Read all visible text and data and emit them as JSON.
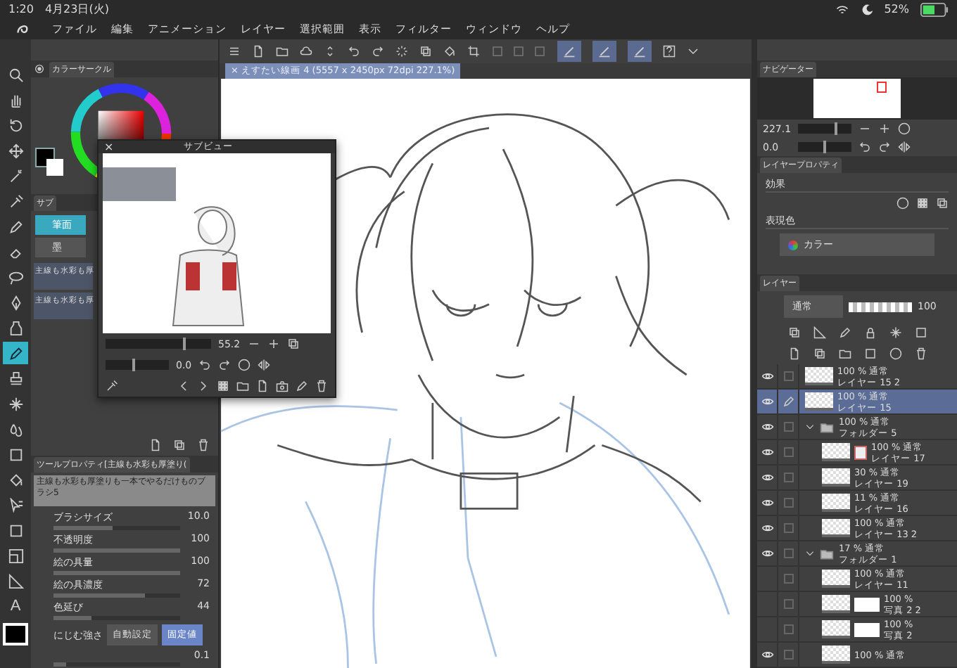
{
  "status_bar": {
    "time": "1:20",
    "date": "4月23日(火)",
    "battery": "52%"
  },
  "menu": [
    "ファイル",
    "編集",
    "アニメーション",
    "レイヤー",
    "選択範囲",
    "表示",
    "フィルター",
    "ウィンドウ",
    "ヘルプ"
  ],
  "toolbar": {
    "pen_buttons": [
      {
        "selected": true
      },
      {
        "selected": true
      },
      {
        "selected": true
      }
    ]
  },
  "canvas_tab": {
    "close": "×",
    "title": "えすたい線画 4 (5557 x 2450px 72dpi 227.1%)"
  },
  "tools": [
    {
      "selected": false
    },
    {
      "selected": false
    },
    {
      "selected": false
    },
    {
      "selected": false
    },
    {
      "selected": false
    },
    {
      "selected": false
    },
    {
      "selected": false
    },
    {
      "selected": false
    },
    {
      "selected": false
    },
    {
      "selected": false
    },
    {
      "selected": false
    },
    {
      "selected": true
    },
    {
      "selected": false
    },
    {
      "selected": false
    },
    {
      "selected": false
    },
    {
      "selected": false
    },
    {
      "selected": false
    },
    {
      "selected": false
    },
    {
      "selected": false
    },
    {
      "selected": false
    },
    {
      "selected": false
    },
    {
      "selected": false,
      "glyph": "A"
    }
  ],
  "color_panel": {
    "tab": "カラーサークル"
  },
  "sub_tool_panel": {
    "tab": "サブ",
    "brushes": [
      {
        "label": "筆面",
        "selected": true
      },
      {
        "label": "墨",
        "selected": false
      }
    ],
    "presets": [
      "主線も水彩も厚",
      "主線も水彩も厚"
    ]
  },
  "subview": {
    "close": "×",
    "title": "サブビュー",
    "zoom": "55.2",
    "zoom_slider": {
      "level": 0.75
    },
    "angle": "0.0",
    "angle_slider": {
      "level": 0.45
    }
  },
  "tool_property": {
    "title": "ツールプロパティ[主線も水彩も厚塗り(",
    "brush_name": "主線も水彩も厚塗りも一本でやるだけものブラシ5",
    "rows": [
      {
        "label": "ブラシサイズ",
        "value": "10.0",
        "level": 0.47
      },
      {
        "label": "不透明度",
        "value": "100",
        "level": 1
      },
      {
        "label": "絵の具量",
        "value": "100",
        "level": 1
      },
      {
        "label": "絵の具濃度",
        "value": "72",
        "level": 0.72
      },
      {
        "label": "色延び",
        "value": "44",
        "level": 0.3
      }
    ],
    "bleed_label": "にじむ強さ",
    "bleed_options": [
      {
        "label": "自動設定",
        "selected": false
      },
      {
        "label": "固定値",
        "selected": true
      }
    ],
    "bleed_value": "0.1",
    "bleed_slider": {
      "level": 0.1
    }
  },
  "navigator": {
    "tab": "ナビゲーター",
    "zoom": "227.1",
    "zoom_slider": {
      "level": 0.7
    },
    "angle": "0.0",
    "angle_slider": {
      "level": 0.5
    }
  },
  "layer_property": {
    "tab": "レイヤープロパティ",
    "effect_label": "効果",
    "color_label": "表現色",
    "color_mode": "カラー"
  },
  "layers": {
    "tab": "レイヤー",
    "blend_mode": "通常",
    "opacity": "100",
    "opacity_slider": {
      "level": 1
    },
    "items": [
      {
        "kind": "layer",
        "opacity": "100 %",
        "mode": "通常",
        "name": "レイヤー 15 2",
        "visible": true,
        "selected": false
      },
      {
        "kind": "layer",
        "opacity": "100 %",
        "mode": "通常",
        "name": "レイヤー 15",
        "visible": true,
        "selected": true
      },
      {
        "kind": "folder",
        "opacity": "100 %",
        "mode": "通常",
        "name": "フォルダー 5",
        "visible": true,
        "selected": false,
        "expanded": true,
        "children": [
          {
            "kind": "layer",
            "opacity": "100 %",
            "mode": "通常",
            "name": "レイヤー 17",
            "visible": true,
            "selected": false,
            "masked": true
          },
          {
            "kind": "layer",
            "opacity": "30 %",
            "mode": "通常",
            "name": "レイヤー 19",
            "visible": true,
            "selected": false
          },
          {
            "kind": "layer",
            "opacity": "11 %",
            "mode": "通常",
            "name": "レイヤー 16",
            "visible": true,
            "selected": false
          },
          {
            "kind": "layer",
            "opacity": "100 %",
            "mode": "通常",
            "name": "レイヤー 13 2",
            "visible": true,
            "selected": false
          }
        ]
      },
      {
        "kind": "folder",
        "opacity": "17 %",
        "mode": "通常",
        "name": "フォルダー 1",
        "visible": true,
        "selected": false,
        "expanded": true,
        "children": [
          {
            "kind": "layer",
            "opacity": "100 %",
            "mode": "通常",
            "name": "レイヤー 11",
            "visible": false,
            "selected": false
          },
          {
            "kind": "photo",
            "opacity": "100 %",
            "name": "写真 2 2",
            "visible": false,
            "selected": false
          },
          {
            "kind": "photo",
            "opacity": "100 %",
            "name": "写真 2",
            "visible": false,
            "selected": false
          },
          {
            "kind": "layer",
            "opacity": "100 %",
            "mode": "通常",
            "visible": true,
            "selected": false
          }
        ]
      }
    ]
  }
}
